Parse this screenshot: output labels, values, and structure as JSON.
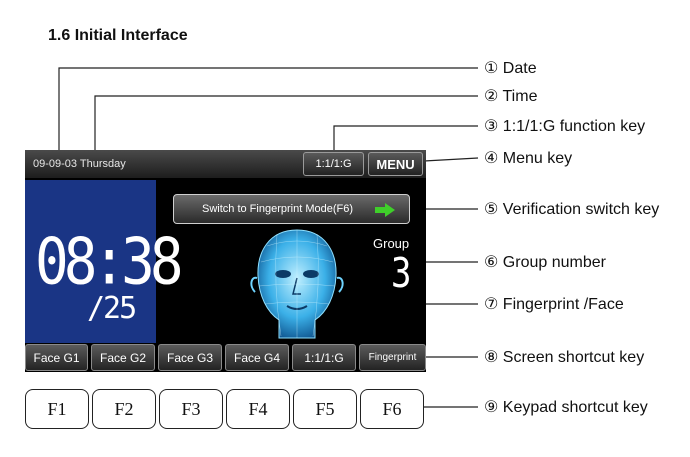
{
  "title": "1.6 Initial Interface",
  "screen": {
    "date": "09-09-03 Thursday",
    "mode_key": "1:1/1:G",
    "menu_key": "MENU",
    "time": "08:38",
    "day": "/25",
    "verify_button": "Switch to Fingerprint Mode(F6)",
    "group_label": "Group",
    "group_number": "3",
    "shortcuts": [
      "Face G1",
      "Face G2",
      "Face G3",
      "Face G4",
      "1:1/1:G",
      "Fingerprint"
    ]
  },
  "keypad": [
    "F1",
    "F2",
    "F3",
    "F4",
    "F5",
    "F6"
  ],
  "callouts": [
    "① Date",
    "② Time",
    "③ 1:1/1:G function key",
    "④ Menu key",
    "⑤ Verification switch key",
    "⑥ Group number",
    "⑦ Fingerprint /Face",
    "⑧ Screen shortcut key",
    "⑨ Keypad shortcut key"
  ],
  "colors": {
    "clock_panel": "#1a3585",
    "arrow": "#3fcf2a",
    "face": "#3bb0e8"
  }
}
